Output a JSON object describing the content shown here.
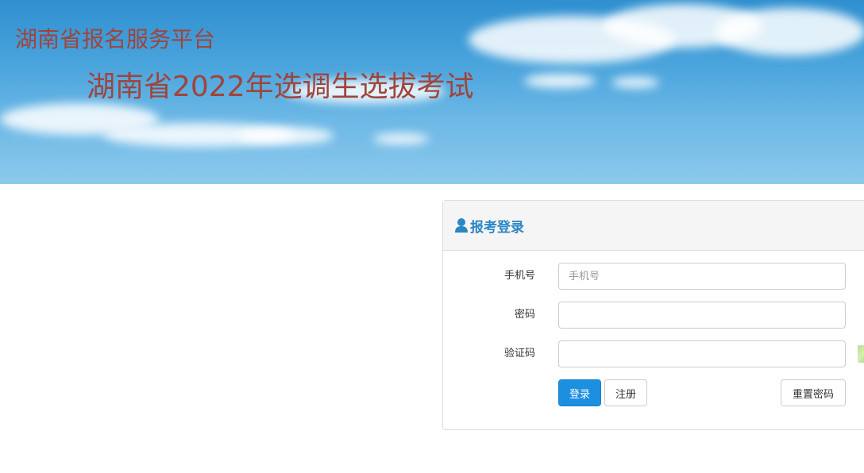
{
  "header": {
    "site_title": "湖南省报名服务平台",
    "exam_title": "湖南省2022年选调生选拔考试"
  },
  "login_panel": {
    "title": "报考登录",
    "icon": "user-icon",
    "fields": {
      "phone": {
        "label": "手机号",
        "placeholder": "手机号",
        "value": ""
      },
      "password": {
        "label": "密码",
        "placeholder": "",
        "value": ""
      },
      "captcha": {
        "label": "验证码",
        "placeholder": "",
        "value": ""
      }
    },
    "buttons": {
      "login": "登录",
      "register": "注册",
      "reset_password": "重置密码"
    }
  },
  "colors": {
    "title_red": "#a0443c",
    "panel_title_blue": "#2b86c5",
    "primary_button": "#1d8fe1"
  }
}
